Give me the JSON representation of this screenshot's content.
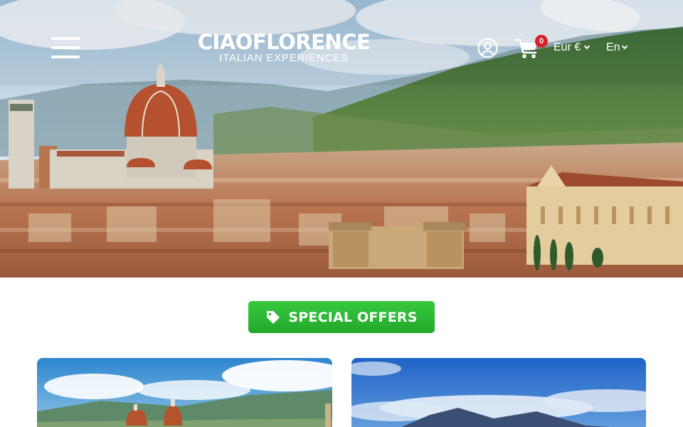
{
  "header": {
    "logo_main": "CIAOFLORENCE",
    "logo_sub": "ITALIAN EXPERIENCES",
    "cart_count": "0",
    "currency": "Eur €",
    "language": "En"
  },
  "offers_button": {
    "label": "SPECIAL OFFERS"
  },
  "icons": [
    "menu-icon",
    "user-icon",
    "cart-icon",
    "chevron-down-icon",
    "tag-icon"
  ],
  "colors": {
    "offers_green": "#2cb934",
    "cart_badge": "#d8212a",
    "header_text": "#ffffff"
  },
  "cards": [
    {
      "image": "Florence skyline with cathedral dome"
    },
    {
      "image": "Mount Vesuvius over the bay"
    }
  ]
}
